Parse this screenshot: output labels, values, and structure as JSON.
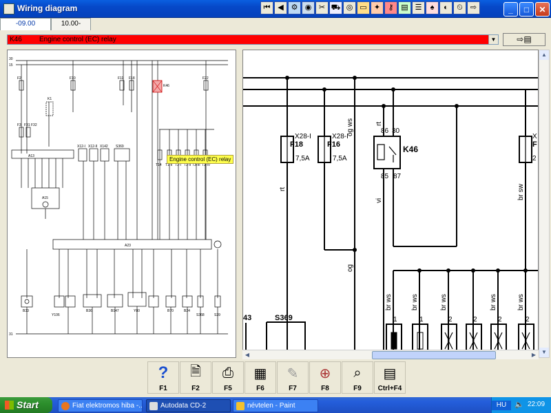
{
  "window": {
    "title": "Wiring diagram"
  },
  "toolbar": {
    "icons": [
      "first-page-icon",
      "prev-page-icon",
      "engine-icon",
      "wheel-icon",
      "tools-icon",
      "car-icon",
      "tire-icon",
      "battery-icon",
      "lamp-icon",
      "key-icon",
      "gauge-icon",
      "airbag-icon",
      "fan-icon",
      "wiper-icon",
      "clock-icon",
      "exit-icon"
    ]
  },
  "tabs": [
    {
      "label": "-09.00"
    },
    {
      "label": "10.00-"
    }
  ],
  "component": {
    "code": "K46",
    "name": "Engine control (EC) relay"
  },
  "tooltip": {
    "text": "Engine control (EC) relay"
  },
  "detail": {
    "fuse_f18_code": "F18",
    "fuse_f18_conn": "X28-I",
    "fuse_f18_rating": "7,5A",
    "fuse_f16_code": "F16",
    "fuse_f16_conn": "X28-I",
    "fuse_f16_rating": "7,5A",
    "relay_code": "K46",
    "relay_pin_86": "86",
    "relay_pin_30": "30",
    "relay_pin_85": "85",
    "relay_pin_87": "87",
    "wire_rt1": "rt",
    "wire_rt2": "rt",
    "wire_og_ws": "og ws",
    "wire_og": "og",
    "wire_vi": "vi",
    "wire_br_sw": "br sw",
    "wire_br_ws1": "br ws",
    "wire_br_ws2": "br ws",
    "wire_br_ws3": "br ws",
    "wire_br_ws4": "br ws",
    "wire_br_ws5": "br ws",
    "pin_1a": "1",
    "pin_1b": "1",
    "pin_2a": "2",
    "pin_2b": "2",
    "pin_2c": "2",
    "pin_2d": "2",
    "label_43": "43",
    "label_s369": "S369",
    "fuse_right_partial": "X",
    "fuse_right_partial2": "F",
    "fuse_right_partial3": "2"
  },
  "overview": {
    "top_rail_1": "30",
    "top_rail_2": "15",
    "bottom_rail": "31",
    "relay_k46": "K46",
    "components": [
      "A13",
      "A15",
      "A23",
      "B33",
      "B36",
      "B147",
      "Y80",
      "B70",
      "B24",
      "S368",
      "S39",
      "K1"
    ],
    "small_labels": [
      "F2",
      "F3",
      "F10",
      "F11",
      "F18",
      "F22",
      "F31",
      "F32",
      "T14",
      "T1-II",
      "T3-I",
      "T3-II",
      "T3-III",
      "T3-IV",
      "X12-I",
      "X12-II",
      "X142",
      "S369",
      "Y106"
    ]
  },
  "fkeys": [
    {
      "label": "F1",
      "icon": "help-question-icon"
    },
    {
      "label": "F2",
      "icon": "print-preview-icon"
    },
    {
      "label": "F5",
      "icon": "printer-icon"
    },
    {
      "label": "F6",
      "icon": "component-list-icon"
    },
    {
      "label": "F7",
      "icon": "pen-icon"
    },
    {
      "label": "F8",
      "icon": "zoom-component-icon"
    },
    {
      "label": "F9",
      "icon": "zoom-tool-icon"
    },
    {
      "label": "Ctrl+F4",
      "icon": "table-grid-icon"
    }
  ],
  "taskbar": {
    "start_label": "Start",
    "tasks": [
      {
        "label": "Fiat elektromos hiba -..."
      },
      {
        "label": "Autodata CD-2"
      },
      {
        "label": "névtelen - Paint"
      }
    ],
    "lang": "HU",
    "clock": "22:09"
  },
  "colors": {
    "title_bar": "#0648c8",
    "select_bg": "#ff0000",
    "tooltip_bg": "#ffff4d",
    "relay_highlight": "#d9534f"
  }
}
